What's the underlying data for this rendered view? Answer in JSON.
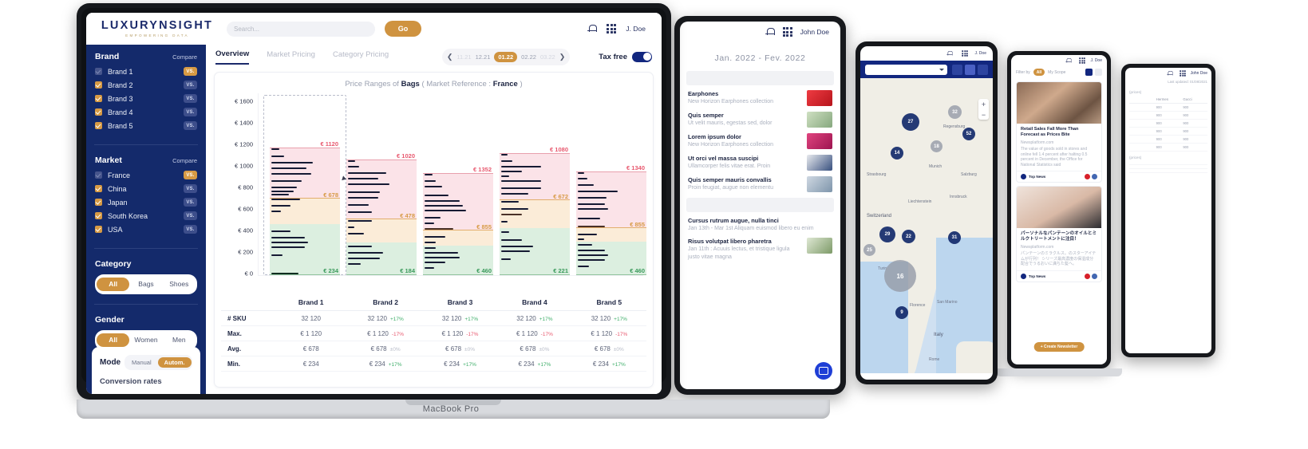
{
  "brand": {
    "logo_main": "LUXURYNSIGHT",
    "logo_sub": "EMPOWERING DATA"
  },
  "topbar": {
    "search_placeholder": "Search...",
    "go_label": "Go",
    "user_name": "J. Doe",
    "bell_icon": "bell-icon",
    "apps_icon": "grid-apps-icon"
  },
  "sidebar": {
    "brand_section": {
      "title": "Brand",
      "compare_label": "Compare",
      "items": [
        {
          "label": "Brand 1",
          "checked": true,
          "dim": true,
          "vs": "VS.",
          "vs_active": true
        },
        {
          "label": "Brand 2",
          "checked": true,
          "dim": false,
          "vs": "VS.",
          "vs_active": false
        },
        {
          "label": "Brand 3",
          "checked": true,
          "dim": false,
          "vs": "VS.",
          "vs_active": false
        },
        {
          "label": "Brand 4",
          "checked": true,
          "dim": false,
          "vs": "VS.",
          "vs_active": false
        },
        {
          "label": "Brand 5",
          "checked": true,
          "dim": false,
          "vs": "VS.",
          "vs_active": false
        }
      ]
    },
    "market_section": {
      "title": "Market",
      "compare_label": "Compare",
      "items": [
        {
          "label": "France",
          "checked": true,
          "dim": true,
          "vs": "VS.",
          "vs_active": true
        },
        {
          "label": "China",
          "checked": true,
          "dim": false,
          "vs": "VS.",
          "vs_active": false
        },
        {
          "label": "Japan",
          "checked": true,
          "dim": false,
          "vs": "VS.",
          "vs_active": false
        },
        {
          "label": "South Korea",
          "checked": true,
          "dim": false,
          "vs": "VS.",
          "vs_active": false
        },
        {
          "label": "USA",
          "checked": true,
          "dim": false,
          "vs": "VS.",
          "vs_active": false
        }
      ]
    },
    "category_section": {
      "title": "Category",
      "options": [
        "All",
        "Bags",
        "Shoes"
      ],
      "selected": "All"
    },
    "gender_section": {
      "title": "Gender",
      "options": [
        "All",
        "Women",
        "Men"
      ],
      "selected": "All"
    },
    "mode_section": {
      "title": "Mode",
      "options": [
        "Manual",
        "Autom."
      ],
      "selected": "Autom.",
      "next_title": "Conversion rates"
    }
  },
  "main": {
    "tabs": [
      {
        "label": "Overview",
        "active": true
      },
      {
        "label": "Market Pricing",
        "active": false
      },
      {
        "label": "Category Pricing",
        "active": false
      }
    ],
    "date_nav": {
      "prev_icon": "chevron-left-icon",
      "next_icon": "chevron-right-icon",
      "pills": [
        {
          "label": "11.21",
          "state": "faint"
        },
        {
          "label": "12.21",
          "state": "normal"
        },
        {
          "label": "01.22",
          "state": "selected"
        },
        {
          "label": "02.22",
          "state": "normal"
        },
        {
          "label": "03.22",
          "state": "faint"
        }
      ]
    },
    "tax_free": {
      "label": "Tax free",
      "enabled": true
    },
    "panel_title_prefix": "Price Ranges of ",
    "panel_title_subject": "Bags",
    "panel_title_mid": " ( Market Reference : ",
    "panel_title_market": "France",
    "panel_title_suffix": " )"
  },
  "chart_data": {
    "type": "bar",
    "title": "Price Ranges of Bags ( Market Reference : France )",
    "xlabel": "",
    "ylabel": "",
    "ylim": [
      0,
      1600
    ],
    "ytick_labels": [
      "€ 1600",
      "€ 1400",
      "€ 1200",
      "€ 1000",
      "€ 800",
      "€ 600",
      "€ 400",
      "€ 200",
      "€ 0"
    ],
    "ytick_values": [
      1600,
      1400,
      1200,
      1000,
      800,
      600,
      400,
      200,
      0
    ],
    "grid": false,
    "categories": [
      "Brand 1",
      "Brand 2",
      "Brand 3",
      "Brand 4",
      "Brand 5"
    ],
    "series": [
      {
        "name": "Max.",
        "values": [
          1120,
          1020,
          1352,
          1080,
          1340
        ],
        "labels": [
          "€ 1120",
          "€ 1020",
          "€ 1352",
          "€ 1080",
          "€ 1340"
        ],
        "color": "#e8596f"
      },
      {
        "name": "Avg.",
        "values": [
          678,
          478,
          855,
          672,
          855
        ],
        "labels": [
          "€ 678",
          "€ 478",
          "€ 855",
          "€ 672",
          "€ 855"
        ],
        "color": "#d79a44"
      },
      {
        "name": "Min.",
        "values": [
          234,
          184,
          460,
          221,
          460
        ],
        "labels": [
          "€ 234",
          "€ 184",
          "€ 460",
          "€ 221",
          "€ 460"
        ],
        "color": "#3a9a5b"
      }
    ],
    "selected_category": "Brand 1"
  },
  "table": {
    "columns": [
      "",
      "Brand 1",
      "Brand 2",
      "Brand 3",
      "Brand 4",
      "Brand 5"
    ],
    "rows": [
      {
        "label": "# SKU",
        "cells": [
          {
            "value": "32 120",
            "delta": "",
            "dir": "none"
          },
          {
            "value": "32 120",
            "delta": "+17%",
            "dir": "up"
          },
          {
            "value": "32 120",
            "delta": "+17%",
            "dir": "up"
          },
          {
            "value": "32 120",
            "delta": "+17%",
            "dir": "up"
          },
          {
            "value": "32 120",
            "delta": "+17%",
            "dir": "up"
          }
        ]
      },
      {
        "label": "Max.",
        "cells": [
          {
            "value": "€ 1 120",
            "delta": "",
            "dir": "none"
          },
          {
            "value": "€ 1 120",
            "delta": "-17%",
            "dir": "down"
          },
          {
            "value": "€ 1 120",
            "delta": "-17%",
            "dir": "down"
          },
          {
            "value": "€ 1 120",
            "delta": "-17%",
            "dir": "down"
          },
          {
            "value": "€ 1 120",
            "delta": "-17%",
            "dir": "down"
          }
        ]
      },
      {
        "label": "Avg.",
        "cells": [
          {
            "value": "€ 678",
            "delta": "",
            "dir": "none"
          },
          {
            "value": "€ 678",
            "delta": "±0%",
            "dir": "flat"
          },
          {
            "value": "€ 678",
            "delta": "±0%",
            "dir": "flat"
          },
          {
            "value": "€ 678",
            "delta": "±0%",
            "dir": "flat"
          },
          {
            "value": "€ 678",
            "delta": "±0%",
            "dir": "flat"
          }
        ]
      },
      {
        "label": "Min.",
        "cells": [
          {
            "value": "€ 234",
            "delta": "",
            "dir": "none"
          },
          {
            "value": "€ 234",
            "delta": "+17%",
            "dir": "up"
          },
          {
            "value": "€ 234",
            "delta": "+17%",
            "dir": "up"
          },
          {
            "value": "€ 234",
            "delta": "+17%",
            "dir": "up"
          },
          {
            "value": "€ 234",
            "delta": "+17%",
            "dir": "up"
          }
        ]
      }
    ]
  },
  "macbook": {
    "model_label": "MacBook Pro"
  },
  "tablet_news": {
    "user_name": "John Doe",
    "date_range": "Jan. 2022 - Fev. 2022",
    "items": [
      {
        "title": "Earphones",
        "text": "New Horizon Earphones collection",
        "thumb": "#d7202a"
      },
      {
        "title": "Quis semper",
        "text": "Ut velit mauris, egestas sed, dolor",
        "thumb": "#9fc6a0"
      },
      {
        "title": "Lorem ipsum dolor",
        "text": "New Horizon Earphones collection",
        "thumb": "#c8286b"
      },
      {
        "title": "Ut orci vel massa suscipi",
        "text": "Ullamcorper felis vitae erat. Proin",
        "thumb": "#3c4e7a"
      },
      {
        "title": "Quis semper mauris convallis",
        "text": "Proin feugiat, augue non elementu",
        "thumb": "#9fb0c4"
      }
    ],
    "events": [
      {
        "title": "Cursus rutrum augue, nulla tinci",
        "text": "Jan 13th - Mar 1st  Aliquam euismod libero eu enim",
        "thumb": ""
      },
      {
        "title": "Risus volutpat libero pharetra",
        "text": "Jan 11th : Acuuis lectus, et tristique ligula justo vitae magna",
        "thumb": "#8fae7a"
      }
    ],
    "chat_icon": "chat-bubble-icon"
  },
  "tablet_map": {
    "user_name": "J. Doe",
    "zoom_in": "+",
    "zoom_out": "−",
    "camera_icon": "camera-icon",
    "layers_icon": "layers-icon",
    "grid_icon": "grid-icon",
    "labels": [
      "Strasbourg",
      "Regensburg",
      "Munich",
      "Salzburg",
      "Innsbruck",
      "Liechtenstein",
      "Switzerland",
      "Turin",
      "Florence",
      "San Marino",
      "Italy",
      "Rome"
    ],
    "clusters": [
      "27",
      "32",
      "52",
      "18",
      "14",
      "29",
      "25",
      "22",
      "16",
      "31",
      "9"
    ]
  },
  "laptop_news": {
    "user_name": "J. Doe",
    "filter_by_label": "Filter by",
    "filter_all": "All",
    "filter_scope": "My Scope",
    "cards": [
      {
        "title": "Retail Sales Fall More Than Forecast as Prices Bite",
        "text": "The value of goods sold in stores and online fell 1.4 percent after halting 0.5 percent in December, the Office for National Statistics said",
        "source": "Newsplatform.com"
      },
      {
        "title": "パーソナルなパンテーンのオイルとミルクトリートメントに注目！",
        "text": "パンテーンのミラクルス。のスターアイテムが行列！ シリーズ最高濃度の保湿成分配合でうるおいに満ちた髪へ。",
        "source": "Newsplatform.com"
      }
    ],
    "top_news_label": "Top News",
    "newsletter_button": "+ Create Newsletter"
  },
  "tablet_table": {
    "user_name": "John Doe",
    "last_updated": "Last updated: 01/08/2021",
    "columns": [
      "",
      "Hermes",
      "Gucci"
    ],
    "caption": "(prices)",
    "rows": [
      {
        "label": "",
        "cells": [
          "900",
          "900"
        ]
      },
      {
        "label": "",
        "cells": [
          "900",
          "900"
        ]
      },
      {
        "label": "",
        "cells": [
          "900",
          "900"
        ]
      },
      {
        "label": "",
        "cells": [
          "900",
          "900"
        ]
      },
      {
        "label": "",
        "cells": [
          "900",
          "900"
        ]
      },
      {
        "label": "",
        "cells": [
          "900",
          "900"
        ]
      }
    ],
    "caption2": "(prices)"
  }
}
